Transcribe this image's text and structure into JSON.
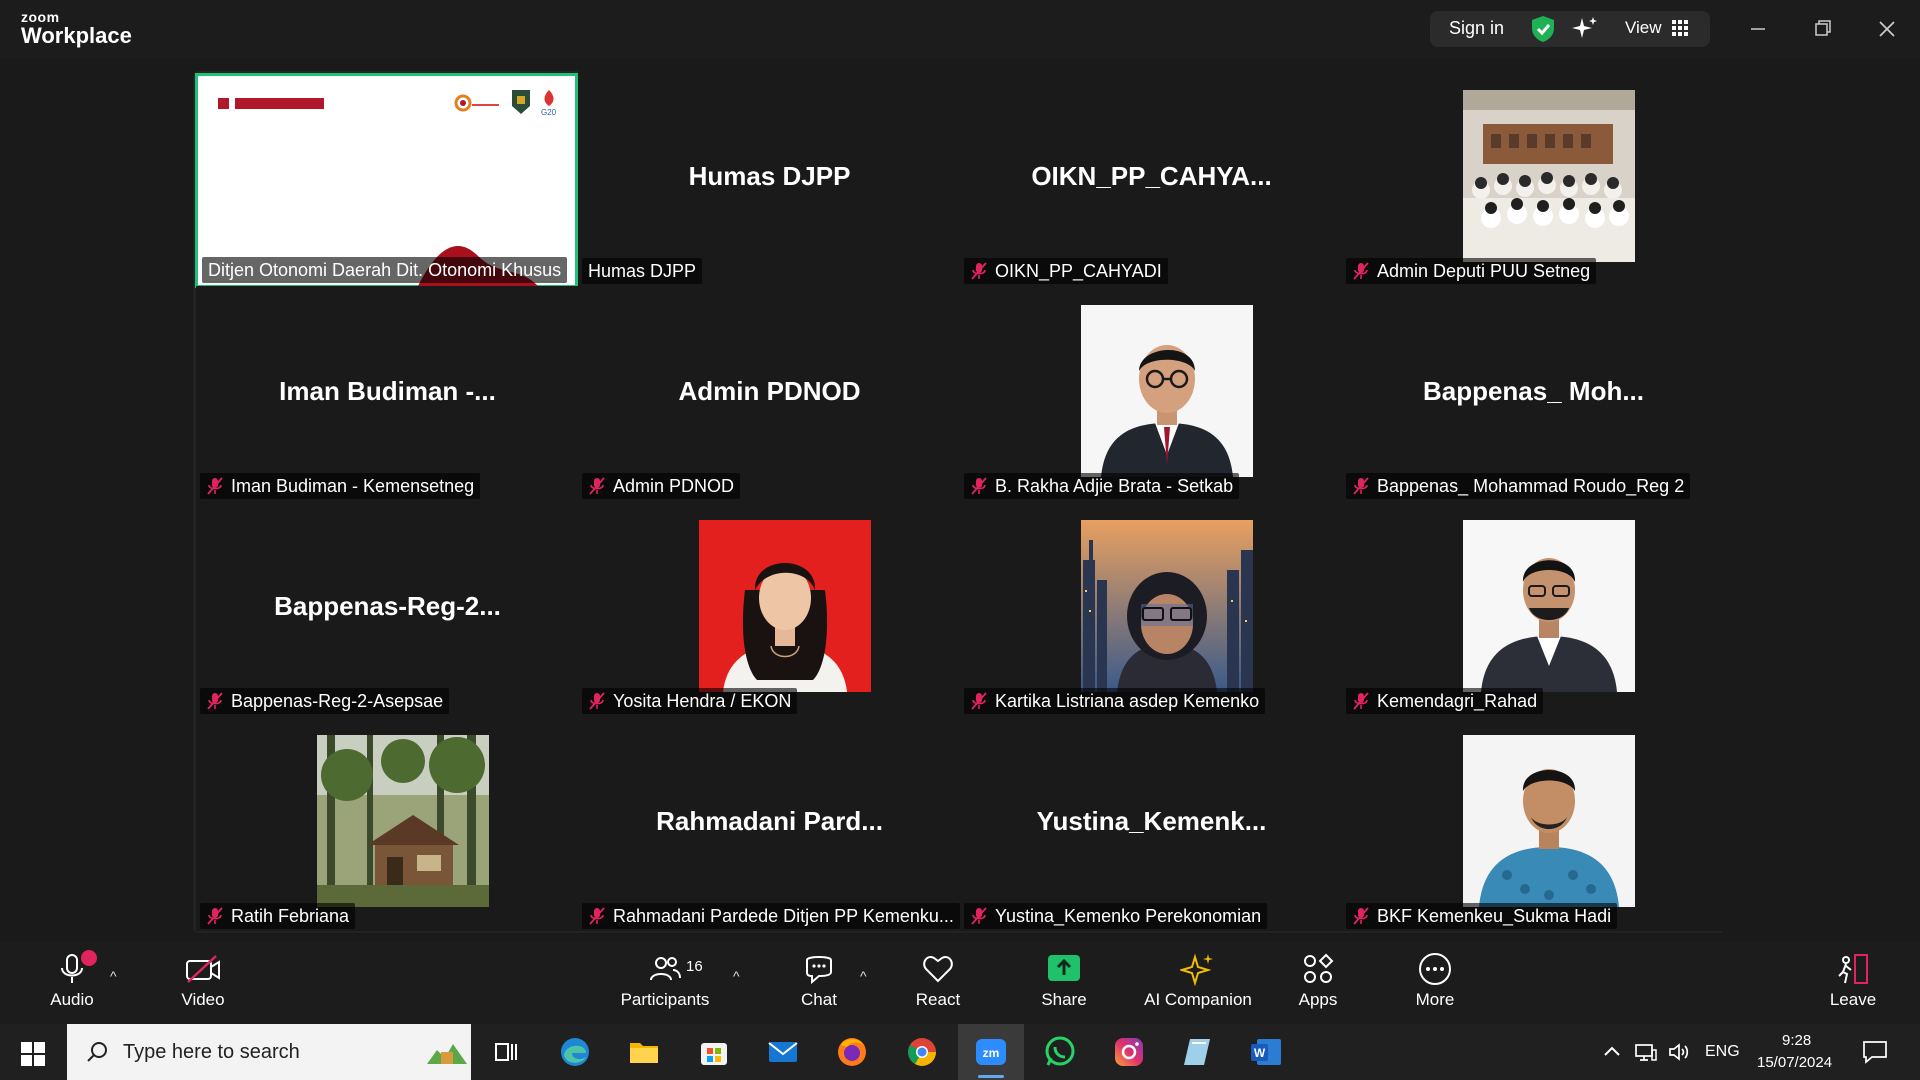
{
  "app": {
    "brand_small": "zoom",
    "brand_big": "Workplace"
  },
  "titlebar": {
    "sign_in": "Sign in",
    "view_label": "View"
  },
  "tiles": [
    {
      "big_name": "",
      "label": "Ditjen Otonomi Daerah Dit. Otonomi Khusus",
      "muted": false,
      "active": true,
      "kind": "slide"
    },
    {
      "big_name": "Humas DJPP",
      "label": "Humas DJPP",
      "muted": false,
      "active": false,
      "kind": "name"
    },
    {
      "big_name": "OIKN_PP_CAHYA...",
      "label": "OIKN_PP_CAHYADI",
      "muted": true,
      "active": false,
      "kind": "name"
    },
    {
      "big_name": "",
      "label": "Admin Deputi PUU Setneg",
      "muted": true,
      "active": false,
      "kind": "photo-group"
    },
    {
      "big_name": "Iman Budiman -...",
      "label": "Iman Budiman - Kemensetneg",
      "muted": true,
      "active": false,
      "kind": "name"
    },
    {
      "big_name": "Admin PDNOD",
      "label": "Admin PDNOD",
      "muted": true,
      "active": false,
      "kind": "name"
    },
    {
      "big_name": "",
      "label": "B. Rakha Adjie Brata - Setkab",
      "muted": true,
      "active": false,
      "kind": "photo-man-white"
    },
    {
      "big_name": "Bappenas_ Moh...",
      "label": "Bappenas_ Mohammad Roudo_Reg 2",
      "muted": true,
      "active": false,
      "kind": "name"
    },
    {
      "big_name": "Bappenas-Reg-2...",
      "label": "Bappenas-Reg-2-Asepsae",
      "muted": true,
      "active": false,
      "kind": "name"
    },
    {
      "big_name": "",
      "label": "Yosita Hendra / EKON",
      "muted": true,
      "active": false,
      "kind": "photo-woman-red"
    },
    {
      "big_name": "",
      "label": "Kartika Listriana asdep Kemenko",
      "muted": true,
      "active": false,
      "kind": "photo-woman-city"
    },
    {
      "big_name": "",
      "label": "Kemendagri_Rahad",
      "muted": true,
      "active": false,
      "kind": "photo-man-suit"
    },
    {
      "big_name": "",
      "label": "Ratih Febriana",
      "muted": true,
      "active": false,
      "kind": "photo-forest"
    },
    {
      "big_name": "Rahmadani Pard...",
      "label": "Rahmadani Pardede Ditjen PP Kemenku...",
      "muted": true,
      "active": false,
      "kind": "name"
    },
    {
      "big_name": "Yustina_Kemenk...",
      "label": "Yustina_Kemenko Perekonomian",
      "muted": true,
      "active": false,
      "kind": "name"
    },
    {
      "big_name": "",
      "label": "BKF Kemenkeu_Sukma Hadi",
      "muted": true,
      "active": false,
      "kind": "photo-man-batik"
    }
  ],
  "toolbar": {
    "audio": "Audio",
    "video": "Video",
    "participants": "Participants",
    "participants_count": "16",
    "chat": "Chat",
    "react": "React",
    "share": "Share",
    "ai_companion": "AI Companion",
    "apps": "Apps",
    "more": "More",
    "leave": "Leave"
  },
  "taskbar": {
    "search_placeholder": "Type here to search",
    "language": "ENG",
    "time": "9:28",
    "date": "15/07/2024"
  },
  "colors": {
    "active_border": "#22c17a",
    "muted_icon": "#e0245e",
    "share_green": "#1fc16b"
  }
}
